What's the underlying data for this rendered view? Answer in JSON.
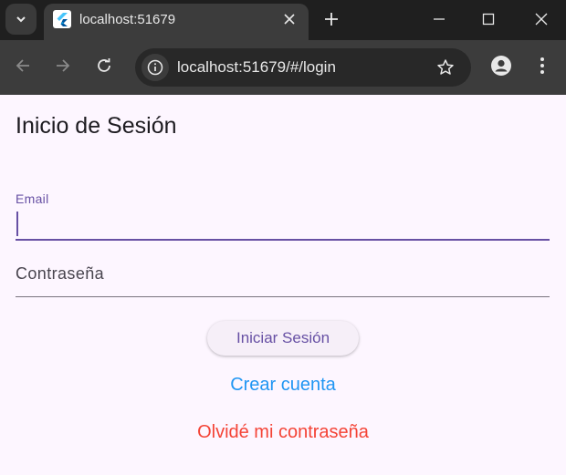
{
  "browser": {
    "tab_title": "localhost:51679",
    "url": "localhost:51679/#/login",
    "icons": {
      "tab_dropdown": "chevron-down-icon",
      "favicon": "flutter-icon",
      "tab_close": "close-icon",
      "new_tab": "plus-icon",
      "minimize": "minimize-icon",
      "maximize": "maximize-icon",
      "close_window": "close-window-icon",
      "back": "back-arrow-icon",
      "forward": "forward-arrow-icon",
      "reload": "reload-icon",
      "site_info": "site-info-icon",
      "bookmark": "star-icon",
      "profile": "profile-icon",
      "menu": "more-vert-icon"
    }
  },
  "login": {
    "title": "Inicio de Sesión",
    "email_label": "Email",
    "email_value": "",
    "password_placeholder": "Contraseña",
    "login_button": "Iniciar Sesión",
    "create_account": "Crear cuenta",
    "forgot_password": "Olvidé mi contraseña"
  },
  "colors": {
    "primary": "#6750a4",
    "link": "#2196f3",
    "danger": "#f44336",
    "page_background": "#fdf6ff"
  }
}
